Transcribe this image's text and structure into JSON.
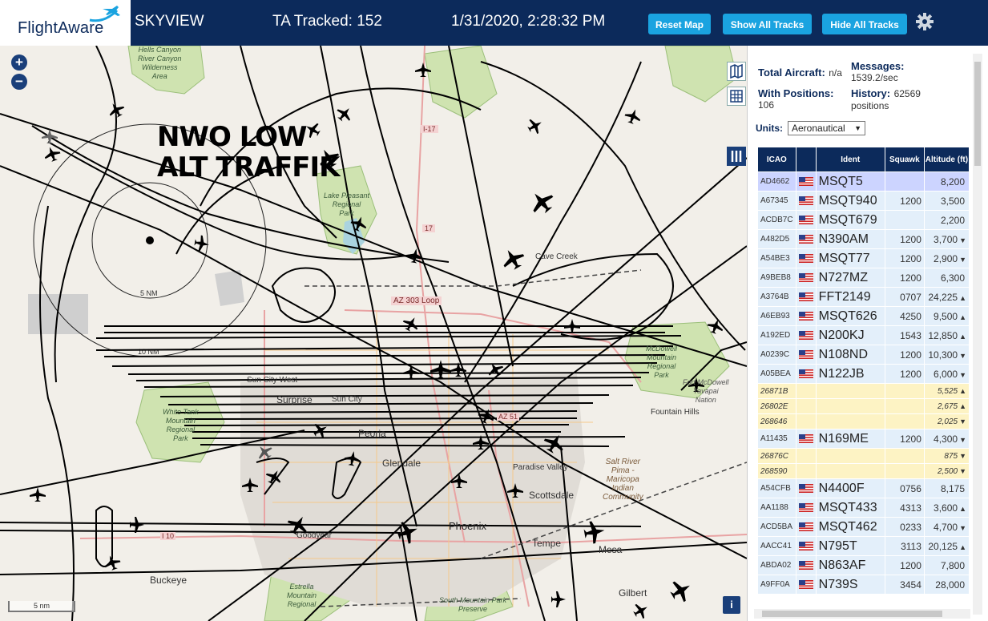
{
  "header": {
    "brand": "FlightAware",
    "app_name": "SKYVIEW",
    "ta_tracked": "TA Tracked: 152",
    "datetime": "1/31/2020, 2:28:32 PM",
    "reset_map": "Reset Map",
    "show_all_tracks": "Show All Tracks",
    "hide_all_tracks": "Hide All Tracks",
    "settings_icon": "gear-icon"
  },
  "map": {
    "overlay_text_line1": "NWO LOW",
    "overlay_text_line2": "ALT TRAFFIK",
    "range_rings": [
      "5 NM",
      "10 NM"
    ],
    "zoom_in": "+",
    "zoom_out": "−",
    "scale_label": "5 nm",
    "info_icon": "i",
    "places": [
      {
        "text": "Hells Canyon"
      },
      {
        "text": "River Canyon"
      },
      {
        "text": "Wilderness"
      },
      {
        "text": "Area"
      },
      {
        "text": "I-17"
      },
      {
        "text": "Lake Pleasant"
      },
      {
        "text": "Regional"
      },
      {
        "text": "Park"
      },
      {
        "text": "17"
      },
      {
        "text": "Cave Creek"
      },
      {
        "text": "AZ 303 Loop"
      },
      {
        "text": "McDowell"
      },
      {
        "text": "Mountain"
      },
      {
        "text": "Regional"
      },
      {
        "text": "Park"
      },
      {
        "text": "Fort McDowell"
      },
      {
        "text": "Yavapai"
      },
      {
        "text": "Nation"
      },
      {
        "text": "Sun City West"
      },
      {
        "text": "Surprise"
      },
      {
        "text": "Sun City"
      },
      {
        "text": "Fountain Hills"
      },
      {
        "text": "White Tank"
      },
      {
        "text": "Mountain"
      },
      {
        "text": "Regional"
      },
      {
        "text": "Park"
      },
      {
        "text": "Peoria"
      },
      {
        "text": "AZ 51"
      },
      {
        "text": "Glendale"
      },
      {
        "text": "Paradise Valley"
      },
      {
        "text": "Salt River"
      },
      {
        "text": "Pima -"
      },
      {
        "text": "Maricopa"
      },
      {
        "text": "Indian"
      },
      {
        "text": "Community"
      },
      {
        "text": "Scottsdale"
      },
      {
        "text": "Phoenix"
      },
      {
        "text": "I 10"
      },
      {
        "text": "Goodyear"
      },
      {
        "text": "Tempe"
      },
      {
        "text": "Mesa"
      },
      {
        "text": "Buckeye"
      },
      {
        "text": "Estrella"
      },
      {
        "text": "Mountain"
      },
      {
        "text": "Regional"
      },
      {
        "text": "South Mountain Park"
      },
      {
        "text": "Preserve"
      },
      {
        "text": "Gilbert"
      }
    ]
  },
  "panel": {
    "total_aircraft_label": "Total Aircraft:",
    "total_aircraft_value": "n/a",
    "messages_label": "Messages:",
    "messages_value": "1539.2/sec",
    "with_positions_label": "With Positions:",
    "with_positions_value": "106",
    "history_label": "History:",
    "history_value": "62569",
    "history_unit": "positions",
    "units_label": "Units:",
    "units_value": "Aeronautical",
    "columns": [
      "ICAO",
      "",
      "Ident",
      "Squawk",
      "Altitude (ft)"
    ],
    "rows": [
      {
        "icao": "AD4662",
        "ident": "MSQT5",
        "squawk": "",
        "alt": "8,200",
        "trend": "",
        "type": "sel"
      },
      {
        "icao": "A67345",
        "ident": "MSQT940",
        "squawk": "1200",
        "alt": "3,500",
        "trend": "",
        "type": "row"
      },
      {
        "icao": "ACDB7C",
        "ident": "MSQT679",
        "squawk": "",
        "alt": "2,200",
        "trend": "",
        "type": "row"
      },
      {
        "icao": "A482D5",
        "ident": "N390AM",
        "squawk": "1200",
        "alt": "3,700",
        "trend": "▼",
        "type": "row"
      },
      {
        "icao": "A54BE3",
        "ident": "MSQT77",
        "squawk": "1200",
        "alt": "2,900",
        "trend": "▼",
        "type": "row"
      },
      {
        "icao": "A9BEB8",
        "ident": "N727MZ",
        "squawk": "1200",
        "alt": "6,300",
        "trend": "",
        "type": "row"
      },
      {
        "icao": "A3764B",
        "ident": "FFT2149",
        "squawk": "0707",
        "alt": "24,225",
        "trend": "▲",
        "type": "row"
      },
      {
        "icao": "A6EB93",
        "ident": "MSQT626",
        "squawk": "4250",
        "alt": "9,500",
        "trend": "▲",
        "type": "row"
      },
      {
        "icao": "A192ED",
        "ident": "N200KJ",
        "squawk": "1543",
        "alt": "12,850",
        "trend": "▲",
        "type": "row"
      },
      {
        "icao": "A0239C",
        "ident": "N108ND",
        "squawk": "1200",
        "alt": "10,300",
        "trend": "▼",
        "type": "row"
      },
      {
        "icao": "A05BEA",
        "ident": "N122JB",
        "squawk": "1200",
        "alt": "6,000",
        "trend": "▼",
        "type": "row"
      },
      {
        "icao": "26871B",
        "ident": "",
        "squawk": "",
        "alt": "5,525",
        "trend": "▲",
        "type": "yel"
      },
      {
        "icao": "26802E",
        "ident": "",
        "squawk": "",
        "alt": "2,675",
        "trend": "▲",
        "type": "yel"
      },
      {
        "icao": "268646",
        "ident": "",
        "squawk": "",
        "alt": "2,025",
        "trend": "▼",
        "type": "yel"
      },
      {
        "icao": "A11435",
        "ident": "N169ME",
        "squawk": "1200",
        "alt": "4,300",
        "trend": "▼",
        "type": "row"
      },
      {
        "icao": "26876C",
        "ident": "",
        "squawk": "",
        "alt": "875",
        "trend": "▼",
        "type": "yel"
      },
      {
        "icao": "268590",
        "ident": "",
        "squawk": "",
        "alt": "2,500",
        "trend": "▼",
        "type": "yel"
      },
      {
        "icao": "A54CFB",
        "ident": "N4400F",
        "squawk": "0756",
        "alt": "8,175",
        "trend": "",
        "type": "row"
      },
      {
        "icao": "AA1188",
        "ident": "MSQT433",
        "squawk": "4313",
        "alt": "3,600",
        "trend": "▲",
        "type": "row"
      },
      {
        "icao": "ACD5BA",
        "ident": "MSQT462",
        "squawk": "0233",
        "alt": "4,700",
        "trend": "▼",
        "type": "row"
      },
      {
        "icao": "AACC41",
        "ident": "N795T",
        "squawk": "3113",
        "alt": "20,125",
        "trend": "▲",
        "type": "row"
      },
      {
        "icao": "ABDA02",
        "ident": "N863AF",
        "squawk": "1200",
        "alt": "7,800",
        "trend": "",
        "type": "row"
      },
      {
        "icao": "A9FF0A",
        "ident": "N739S",
        "squawk": "3454",
        "alt": "28,000",
        "trend": "",
        "type": "row"
      }
    ]
  },
  "colors": {
    "header_bg": "#0c2a5b",
    "button_bg": "#1aa3e0",
    "row_bg": "#e3effa",
    "selected_row": "#ccd4ff",
    "unidentified_row": "#fdf3c4",
    "map_bg": "#f2efe9",
    "park_green": "#c8dfa8"
  }
}
